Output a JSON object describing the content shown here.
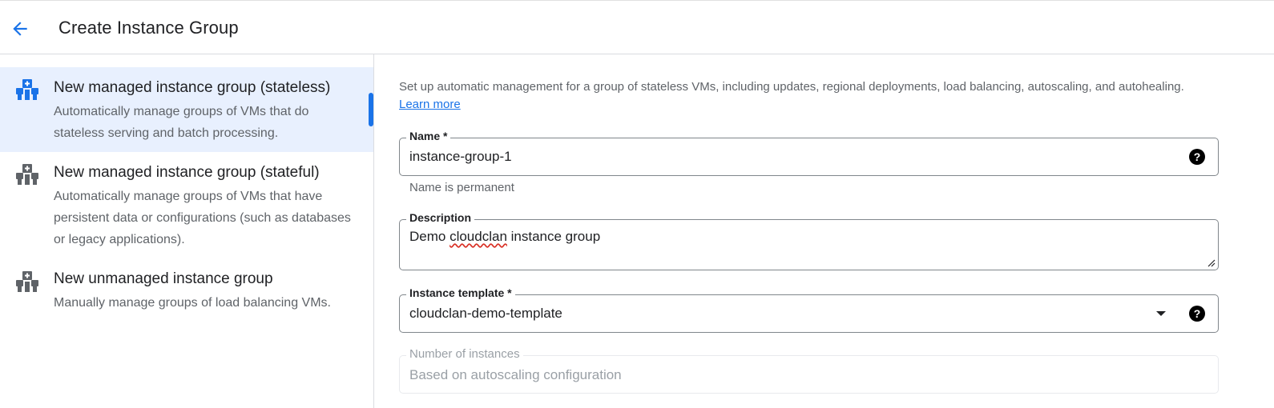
{
  "header": {
    "title": "Create Instance Group",
    "back_icon": "arrow-back-icon"
  },
  "colors": {
    "accent": "#1a73e8",
    "selected_bg": "#e8f0fe",
    "icon_blue": "#1a73e8",
    "icon_gray": "#5f6368"
  },
  "sidebar": {
    "options": [
      {
        "title": "New managed instance group (stateless)",
        "description": "Automatically manage groups of VMs that do stateless serving and batch processing.",
        "selected": true,
        "icon": "managed-group-icon"
      },
      {
        "title": "New managed instance group (stateful)",
        "description": "Automatically manage groups of VMs that have persistent data or configurations (such as databases or legacy applications).",
        "selected": false,
        "icon": "managed-group-icon"
      },
      {
        "title": "New unmanaged instance group",
        "description": "Manually manage groups of load balancing VMs.",
        "selected": false,
        "icon": "unmanaged-group-icon"
      }
    ]
  },
  "main": {
    "intro": "Set up automatic management for a group of stateless VMs, including updates, regional deployments, load balancing, autoscaling, and autohealing.",
    "learn_more": "Learn more",
    "name": {
      "label": "Name *",
      "value": "instance-group-1",
      "hint": "Name is permanent"
    },
    "description": {
      "label": "Description",
      "value_prefix": "Demo ",
      "value_misspelled": "cloudclan",
      "value_suffix": " instance group"
    },
    "template": {
      "label": "Instance template *",
      "value": "cloudclan-demo-template"
    },
    "instances": {
      "label": "Number of instances",
      "value": "Based on autoscaling configuration"
    },
    "help_glyph": "?"
  }
}
